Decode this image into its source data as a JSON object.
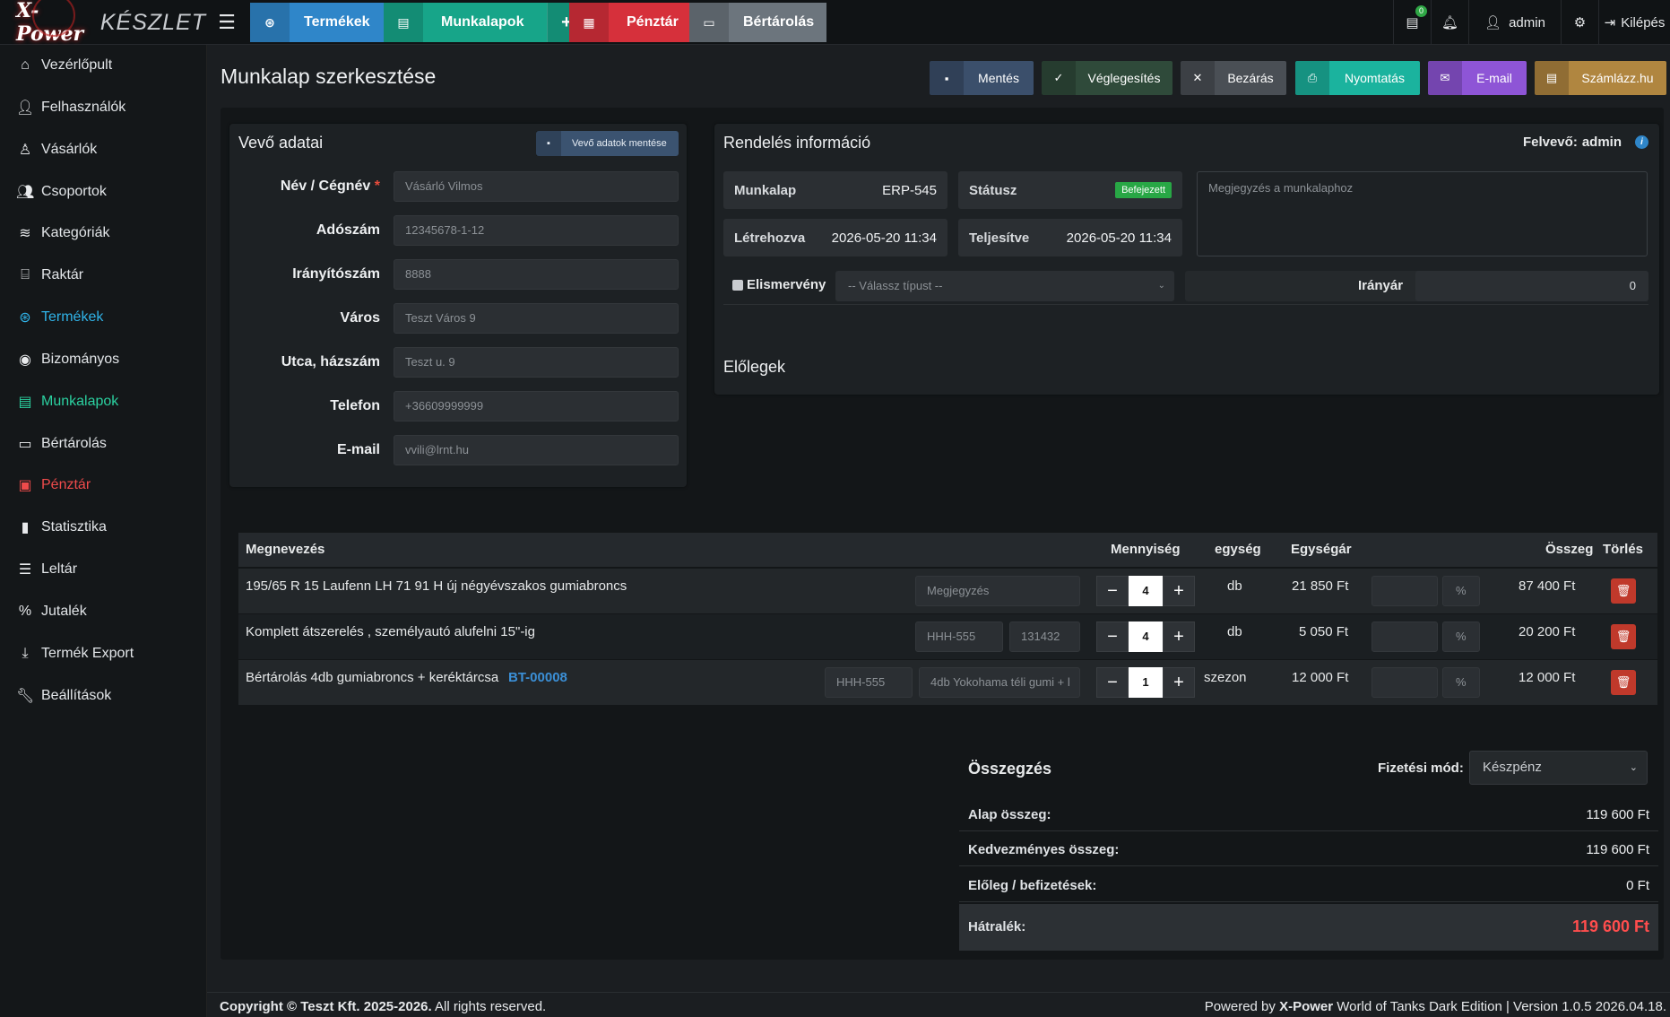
{
  "brand": {
    "logo": "X-Power",
    "sub": "KÉSZLET"
  },
  "topnav": {
    "termekek": "Termékek",
    "munkalapok": "Munkalapok",
    "plus": "+",
    "penztar": "Pénztár",
    "bertarolas": "Bértárolás",
    "notif_count": "0",
    "user": "admin",
    "logout": "Kilépés"
  },
  "sidebar": {
    "items": [
      {
        "label": "Vezérlőpult",
        "icon": "home-icon"
      },
      {
        "label": "Felhasználók",
        "icon": "user-icon"
      },
      {
        "label": "Vásárlók",
        "icon": "user-outline-icon"
      },
      {
        "label": "Csoportok",
        "icon": "users-icon"
      },
      {
        "label": "Kategóriák",
        "icon": "layers-icon"
      },
      {
        "label": "Raktár",
        "icon": "warehouse-icon"
      },
      {
        "label": "Termékek",
        "icon": "tire-icon"
      },
      {
        "label": "Bizományos",
        "icon": "user-circle-icon"
      },
      {
        "label": "Munkalapok",
        "icon": "file-icon"
      },
      {
        "label": "Bértárolás",
        "icon": "archive-icon"
      },
      {
        "label": "Pénztár",
        "icon": "money-icon"
      },
      {
        "label": "Statisztika",
        "icon": "chart-icon"
      },
      {
        "label": "Leltár",
        "icon": "list-icon"
      },
      {
        "label": "Jutalék",
        "icon": "percent-icon"
      },
      {
        "label": "Termék Export",
        "icon": "download-icon"
      },
      {
        "label": "Beállítások",
        "icon": "wrench-icon"
      }
    ]
  },
  "page": {
    "title": "Munkalap szerkesztése"
  },
  "actions": {
    "save": "Mentés",
    "finalize": "Véglegesítés",
    "close": "Bezárás",
    "print": "Nyomtatás",
    "email": "E-mail",
    "invoice": "Számlázz.hu"
  },
  "customer": {
    "title": "Vevő adatai",
    "save_btn": "Vevő adatok mentése",
    "name_label": "Név / Cégnév",
    "name_required": "*",
    "name_ph": "Vásárló Vilmos",
    "tax_label": "Adószám",
    "tax_ph": "12345678-1-12",
    "zip_label": "Irányítószám",
    "zip_ph": "8888",
    "city_label": "Város",
    "city_ph": "Teszt Város 9",
    "street_label": "Utca, házszám",
    "street_ph": "Teszt u. 9",
    "phone_label": "Telefon",
    "phone_ph": "+36609999999",
    "email_label": "E-mail",
    "email_ph": "vvili@lrnt.hu"
  },
  "order": {
    "title": "Rendelés információ",
    "creator_label": "Felvevő:",
    "creator": "admin",
    "worksheet_k": "Munkalap",
    "worksheet_v": "ERP-545",
    "status_k": "Státusz",
    "status_v": "Befejezett",
    "created_k": "Létrehozva",
    "created_v": "2026-05-20 11:34",
    "done_k": "Teljesítve",
    "done_v": "2026-05-20 11:34",
    "note_ph": "Megjegyzés a munkalaphoz",
    "receipt_label": "Elismervény",
    "receipt_select": "-- Válassz típust --",
    "guide_price_label": "Irányár",
    "guide_price_value": "0",
    "advances_title": "Előlegek"
  },
  "table": {
    "headers": {
      "name": "Megnevezés",
      "qty": "Mennyiség",
      "unit": "egység",
      "unit_price": "Egységár",
      "total": "Összeg",
      "delete": "Törlés"
    },
    "rows": [
      {
        "name": "195/65 R 15 Laufenn LH 71 91 H új négyévszakos gumiabroncs",
        "note_ph": "Megjegyzés",
        "qty": "4",
        "unit": "db",
        "unit_price": "21 850 Ft",
        "pct_ph": "%",
        "total": "87 400 Ft"
      },
      {
        "name": "Komplett átszerelés , személyautó alufelni 15\"-ig",
        "f1": "HHH-555",
        "f2": "131432",
        "qty": "4",
        "unit": "db",
        "unit_price": "5 050 Ft",
        "pct_ph": "%",
        "total": "20 200 Ft"
      },
      {
        "name": "Bértárolás 4db gumiabroncs + keréktárcsa",
        "link": "BT-00008",
        "f1": "HHH-555",
        "f2": "4db Yokohama téli gumi + l",
        "qty": "1",
        "unit": "szezon",
        "unit_price": "12 000 Ft",
        "pct_ph": "%",
        "total": "12 000 Ft"
      }
    ]
  },
  "summary": {
    "title": "Összegzés",
    "payment_label": "Fizetési mód:",
    "payment_value": "Készpénz",
    "base_k": "Alap összeg:",
    "base_v": "119 600 Ft",
    "discount_k": "Kedvezményes összeg:",
    "discount_v": "119 600 Ft",
    "advance_k": "Előleg / befizetések:",
    "advance_v": "0 Ft",
    "due_k": "Hátralék:",
    "due_v": "119 600 Ft"
  },
  "footer": {
    "copyright_bold": "Copyright © Teszt Kft. 2025-2026.",
    "copyright_rest": "All rights reserved.",
    "powered": "Powered by",
    "powered_brand": "X-Power",
    "powered_rest": "World of Tanks Dark Edition | Version 1.0.5 2026.04.18."
  },
  "colors": {
    "accent_blue": "#2f86c9",
    "green": "#17a589",
    "red": "#dc3545",
    "gray": "#6c757d",
    "danger_text": "#ff4d4d"
  }
}
